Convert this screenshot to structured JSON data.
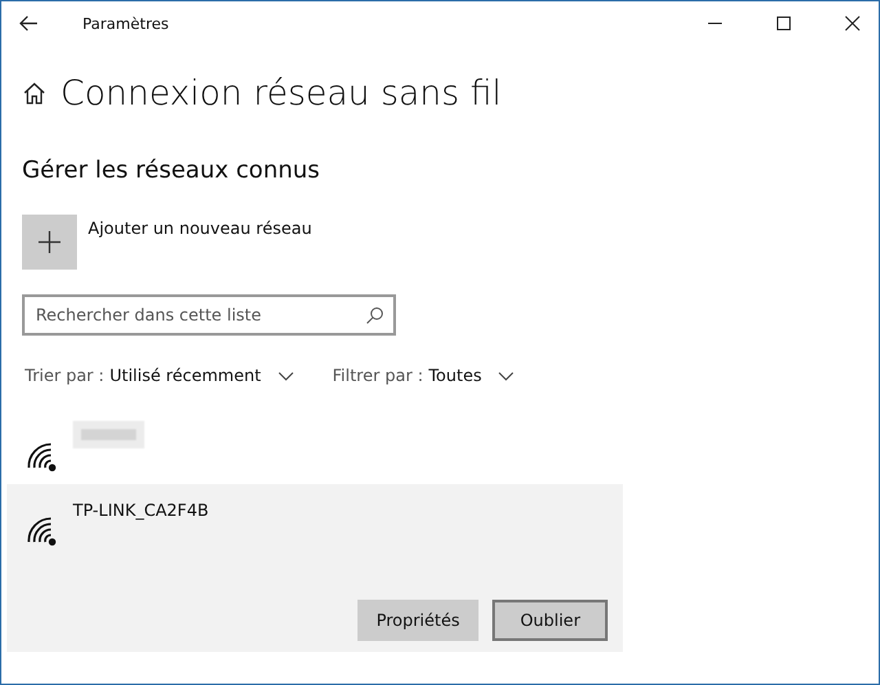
{
  "window": {
    "title": "Paramètres"
  },
  "page": {
    "title": "Connexion réseau sans fil"
  },
  "section": {
    "title": "Gérer les réseaux connus"
  },
  "add_network": {
    "label": "Ajouter un nouveau réseau"
  },
  "search": {
    "placeholder": "Rechercher dans cette liste"
  },
  "sort": {
    "label": "Trier par :",
    "value": "Utilisé récemment"
  },
  "filter": {
    "label": "Filtrer par :",
    "value": "Toutes"
  },
  "networks": [
    {
      "redacted": true,
      "selected": false
    },
    {
      "name": "TP-LINK_CA2F4B",
      "redacted": false,
      "selected": true
    }
  ],
  "network_actions": [
    {
      "label": "Propriétés",
      "focused": false
    },
    {
      "label": "Oublier",
      "focused": true
    }
  ]
}
